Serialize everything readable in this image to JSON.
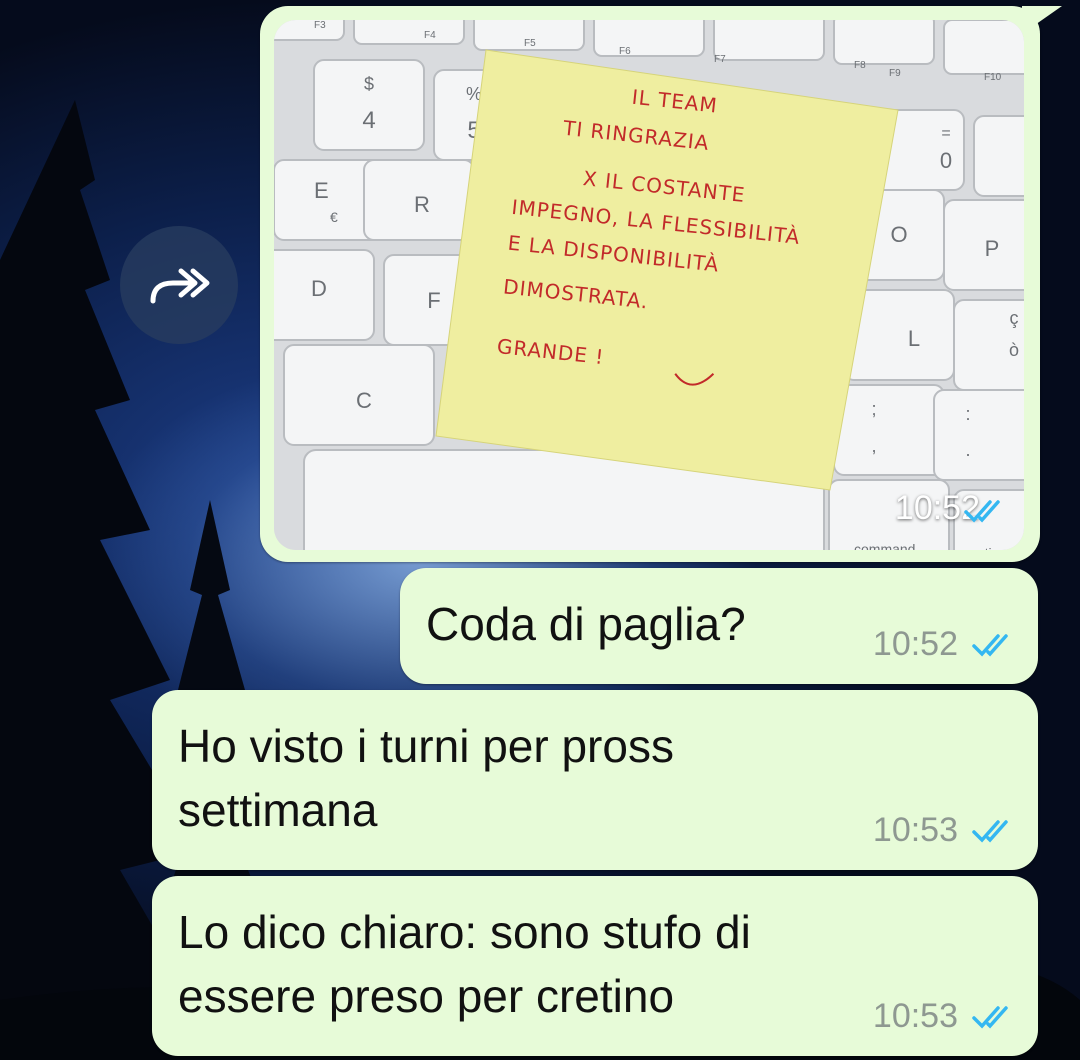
{
  "conversation": {
    "background": "night-forest-wallpaper",
    "forward_icon": "forward-icon",
    "messages": [
      {
        "type": "image",
        "image_description": "sticky-note-on-keyboard",
        "note_lines": [
          "IL TEAM",
          "TI RINGRAZIA",
          "X IL COSTANTE",
          "IMPEGNO, LA FLESSIBILITÀ",
          "E LA DISPONIBILITÀ",
          "DIMOSTRATA.",
          "GRANDE !"
        ],
        "keyboard_labels": [
          "F3",
          "F4",
          "F5",
          "F6",
          "F7",
          "F8",
          "F9",
          "F10",
          "$",
          "4",
          "%",
          "5",
          "=",
          "0",
          "E",
          "€",
          "R",
          "O",
          "P",
          "D",
          "F",
          "L",
          "ç",
          "ò",
          "C",
          ";",
          ",",
          ":",
          ".",
          "command",
          "option"
        ],
        "time": "10:52",
        "status": "read"
      },
      {
        "type": "text",
        "text": "Coda di paglia?",
        "time": "10:52",
        "status": "read"
      },
      {
        "type": "text",
        "text": "Ho visto i turni per pross\nsettimana",
        "time": "10:53",
        "status": "read"
      },
      {
        "type": "text",
        "text": "Lo dico chiaro: sono stufo di\nessere preso per cretino",
        "time": "10:53",
        "status": "read"
      }
    ]
  },
  "colors": {
    "bubble": "#e7fbd8",
    "tick_read": "#34b7f1",
    "time_text": "#8e9891",
    "note": "#efeea0",
    "note_ink": "#c22a2a"
  }
}
